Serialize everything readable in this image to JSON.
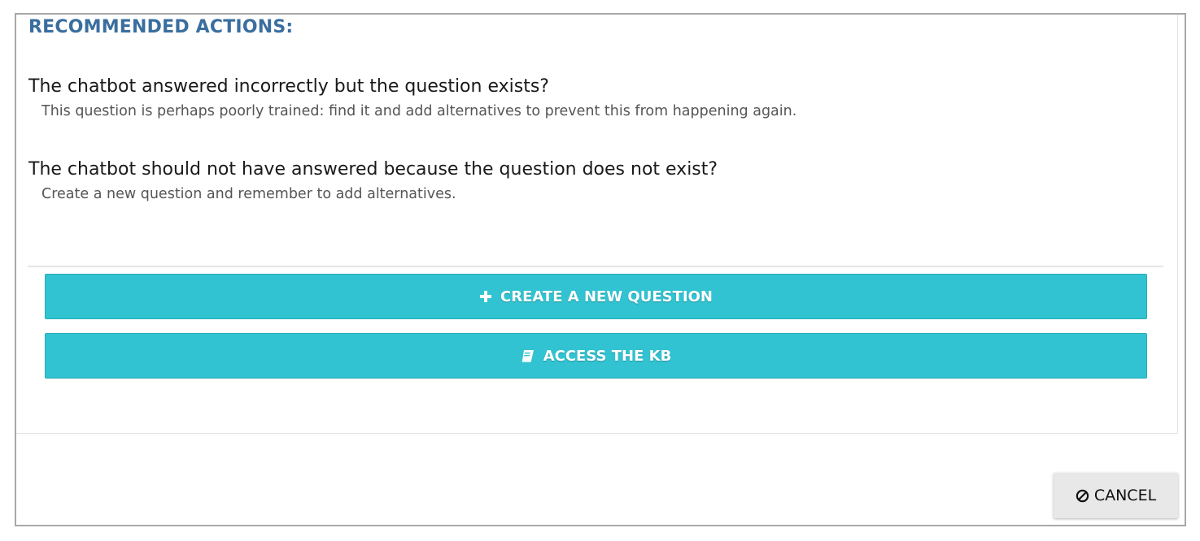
{
  "section": {
    "title": "RECOMMENDED ACTIONS:"
  },
  "actions": [
    {
      "question": "The chatbot answered incorrectly but the question exists?",
      "description": "This question is perhaps poorly trained: find it and add alternatives to prevent this from happening again."
    },
    {
      "question": "The chatbot should not have answered because the question does not exist?",
      "description": "Create a new question and remember to add alternatives."
    }
  ],
  "buttons": {
    "create_question": {
      "label": "CREATE A NEW QUESTION",
      "icon": "plus-icon"
    },
    "access_kb": {
      "label": "ACCESS THE KB",
      "icon": "book-icon"
    }
  },
  "footer": {
    "cancel": {
      "label": "CANCEL",
      "icon": "ban-icon"
    }
  },
  "colors": {
    "accent": "#31c3d1",
    "title": "#3a6e9f"
  }
}
